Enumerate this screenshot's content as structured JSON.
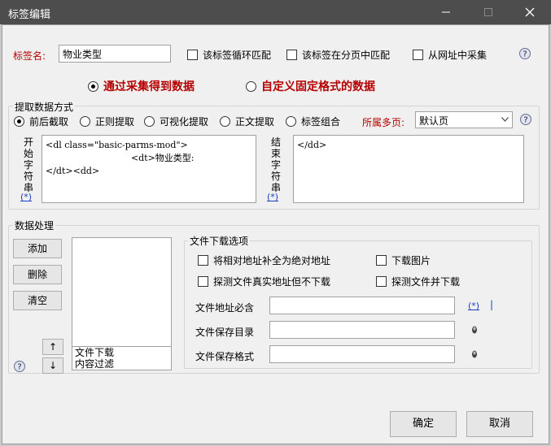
{
  "window": {
    "title": "标签编辑",
    "minimize_icon": "minimize-icon",
    "maximize_icon": "maximize-icon",
    "close_icon": "close-icon"
  },
  "tag": {
    "name_label": "标签名:",
    "name_value": "物业类型",
    "options": [
      {
        "label": "该标签循环匹配",
        "checked": false
      },
      {
        "label": "该标签在分页中匹配",
        "checked": false
      },
      {
        "label": "从网址中采集",
        "checked": false
      }
    ]
  },
  "source": {
    "options": [
      {
        "label": "通过采集得到数据",
        "selected": true
      },
      {
        "label": "自定义固定格式的数据",
        "selected": false
      }
    ]
  },
  "extract": {
    "title": "提取数据方式",
    "methods": [
      {
        "label": "前后截取",
        "selected": true
      },
      {
        "label": "正则提取",
        "selected": false
      },
      {
        "label": "可视化提取",
        "selected": false
      },
      {
        "label": "正文提取",
        "selected": false
      },
      {
        "label": "标签组合",
        "selected": false
      }
    ],
    "page_label": "所属多页:",
    "page_value": "默认页",
    "start_label": [
      "开",
      "始",
      "字",
      "符",
      "串"
    ],
    "start_text": "<dl class=\"basic-parms-mod\">\n                              <dt>物业类型:\n</dt><dd>",
    "start_link": "(*)",
    "end_label": [
      "结",
      "束",
      "字",
      "符",
      "串"
    ],
    "end_text": "</dd>",
    "end_link": "(*)"
  },
  "processing": {
    "title": "数据处理",
    "buttons": {
      "add": "添加",
      "delete": "删除",
      "clear": "清空",
      "up": "↑",
      "down": "↓"
    },
    "list_items": [
      "文件下载",
      "内容过滤"
    ]
  },
  "download": {
    "title": "文件下载选项",
    "checks": [
      {
        "label": "将相对地址补全为绝对地址",
        "checked": false
      },
      {
        "label": "下载图片",
        "checked": false
      },
      {
        "label": "探测文件真实地址但不下载",
        "checked": false
      },
      {
        "label": "探测文件并下载",
        "checked": false
      }
    ],
    "fields": [
      {
        "label": "文件地址必含",
        "value": ""
      },
      {
        "label": "文件保存目录",
        "value": ""
      },
      {
        "label": "文件保存格式",
        "value": ""
      }
    ],
    "addr_link": "(*)",
    "addr_extra": "|"
  },
  "footer": {
    "ok": "确定",
    "cancel": "取消"
  }
}
